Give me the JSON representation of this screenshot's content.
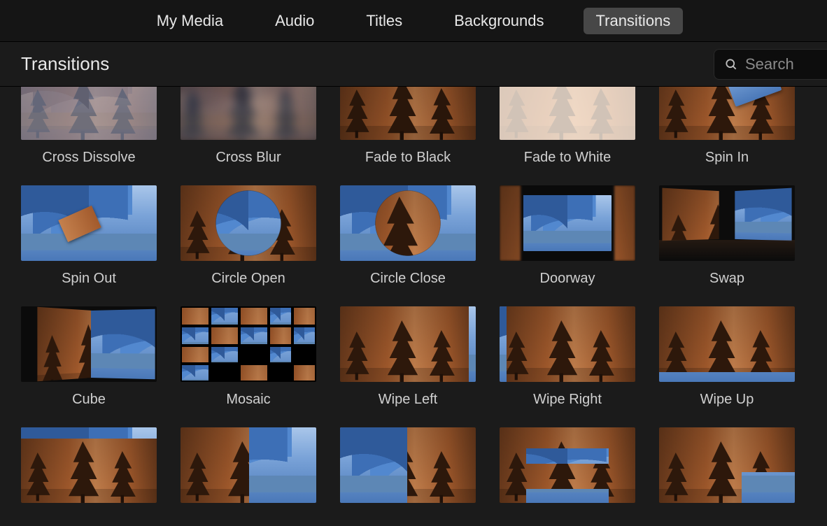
{
  "tabs": {
    "items": [
      "My Media",
      "Audio",
      "Titles",
      "Backgrounds",
      "Transitions"
    ],
    "active_index": 4
  },
  "section": {
    "title": "Transitions"
  },
  "search": {
    "placeholder": "Search",
    "value": ""
  },
  "transitions": {
    "row0": [
      "Cross Dissolve",
      "Cross Blur",
      "Fade to Black",
      "Fade to White",
      "Spin In"
    ],
    "row1": [
      "Spin Out",
      "Circle Open",
      "Circle Close",
      "Doorway",
      "Swap"
    ],
    "row2": [
      "Cube",
      "Mosaic",
      "Wipe Left",
      "Wipe Right",
      "Wipe Up"
    ]
  }
}
